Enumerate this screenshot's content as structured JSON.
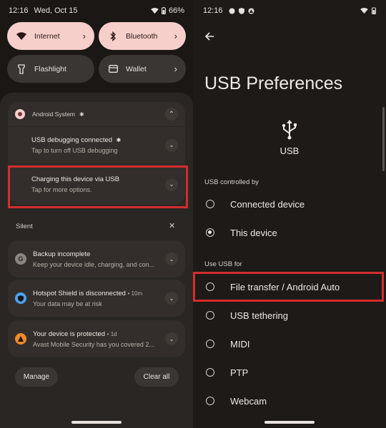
{
  "left": {
    "status": {
      "time": "12:16",
      "date": "Wed, Oct 15",
      "battery": "66%"
    },
    "tiles": [
      {
        "label": "Internet",
        "state": "on",
        "icon": "wifi-icon"
      },
      {
        "label": "Bluetooth",
        "state": "on",
        "icon": "bluetooth-icon"
      },
      {
        "label": "Flashlight",
        "state": "off",
        "icon": "flashlight-icon"
      },
      {
        "label": "Wallet",
        "state": "off",
        "icon": "wallet-icon"
      }
    ],
    "group": {
      "app": "Android System",
      "items": [
        {
          "title": "USB debugging connected",
          "subtitle": "Tap to turn off USB debugging"
        },
        {
          "title": "Charging this device via USB",
          "subtitle": "Tap for more options."
        }
      ]
    },
    "silent": {
      "label": "Silent",
      "items": [
        {
          "title": "Backup incomplete",
          "meta": "",
          "subtitle": "Keep your device idle, charging, and con...",
          "icon_letter": "G",
          "color": "#8a8580"
        },
        {
          "title": "Hotspot Shield is disconnected",
          "meta": "• 10m",
          "subtitle": "Your data may be at risk",
          "icon_letter": "",
          "color": "#4aa3f0"
        },
        {
          "title": "Your device is protected",
          "meta": "• 1d",
          "subtitle": "Avast Mobile Security has you covered 2...",
          "icon_letter": "",
          "color": "#f08a2a"
        }
      ]
    },
    "manage_label": "Manage",
    "clear_label": "Clear all"
  },
  "right": {
    "status": {
      "time": "12:16"
    },
    "title": "USB Preferences",
    "usb_label": "USB",
    "controlled_by": {
      "heading": "USB controlled by",
      "options": [
        {
          "label": "Connected device",
          "selected": false
        },
        {
          "label": "This device",
          "selected": true
        }
      ]
    },
    "use_for": {
      "heading": "Use USB for",
      "options": [
        {
          "label": "File transfer / Android Auto",
          "selected": false
        },
        {
          "label": "USB tethering",
          "selected": false
        },
        {
          "label": "MIDI",
          "selected": false
        },
        {
          "label": "PTP",
          "selected": false
        },
        {
          "label": "Webcam",
          "selected": false
        }
      ]
    }
  },
  "colors": {
    "highlight": "#d32d2d",
    "tile_on": "#f6cfcb",
    "tile_off": "#3a3634"
  }
}
